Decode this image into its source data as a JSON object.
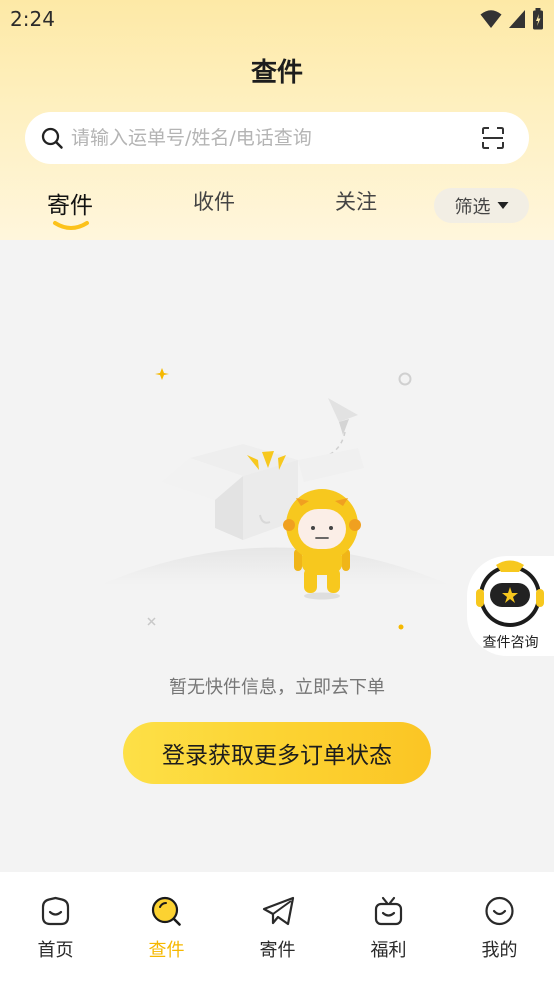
{
  "status_bar": {
    "time": "2:24"
  },
  "header": {
    "title": "查件"
  },
  "search": {
    "placeholder": "请输入运单号/姓名/电话查询"
  },
  "tabs": [
    {
      "label": "寄件",
      "active": true
    },
    {
      "label": "收件",
      "active": false
    },
    {
      "label": "关注",
      "active": false
    }
  ],
  "filter": {
    "label": "筛选"
  },
  "empty_state": {
    "message": "暂无快件信息，立即去下单",
    "button_label": "登录获取更多订单状态"
  },
  "floating_consult": {
    "label": "查件咨询"
  },
  "bottom_nav": [
    {
      "label": "首页",
      "icon": "home-face-icon",
      "active": false
    },
    {
      "label": "查件",
      "icon": "search-parcel-icon",
      "active": true
    },
    {
      "label": "寄件",
      "icon": "paper-plane-icon",
      "active": false
    },
    {
      "label": "福利",
      "icon": "gift-tv-icon",
      "active": false
    },
    {
      "label": "我的",
      "icon": "profile-smile-icon",
      "active": false
    }
  ],
  "colors": {
    "accent": "#FCD231",
    "active_nav": "#F6B800",
    "header_bg": "#FDE9A6",
    "page_bg": "#F3F3F3"
  }
}
